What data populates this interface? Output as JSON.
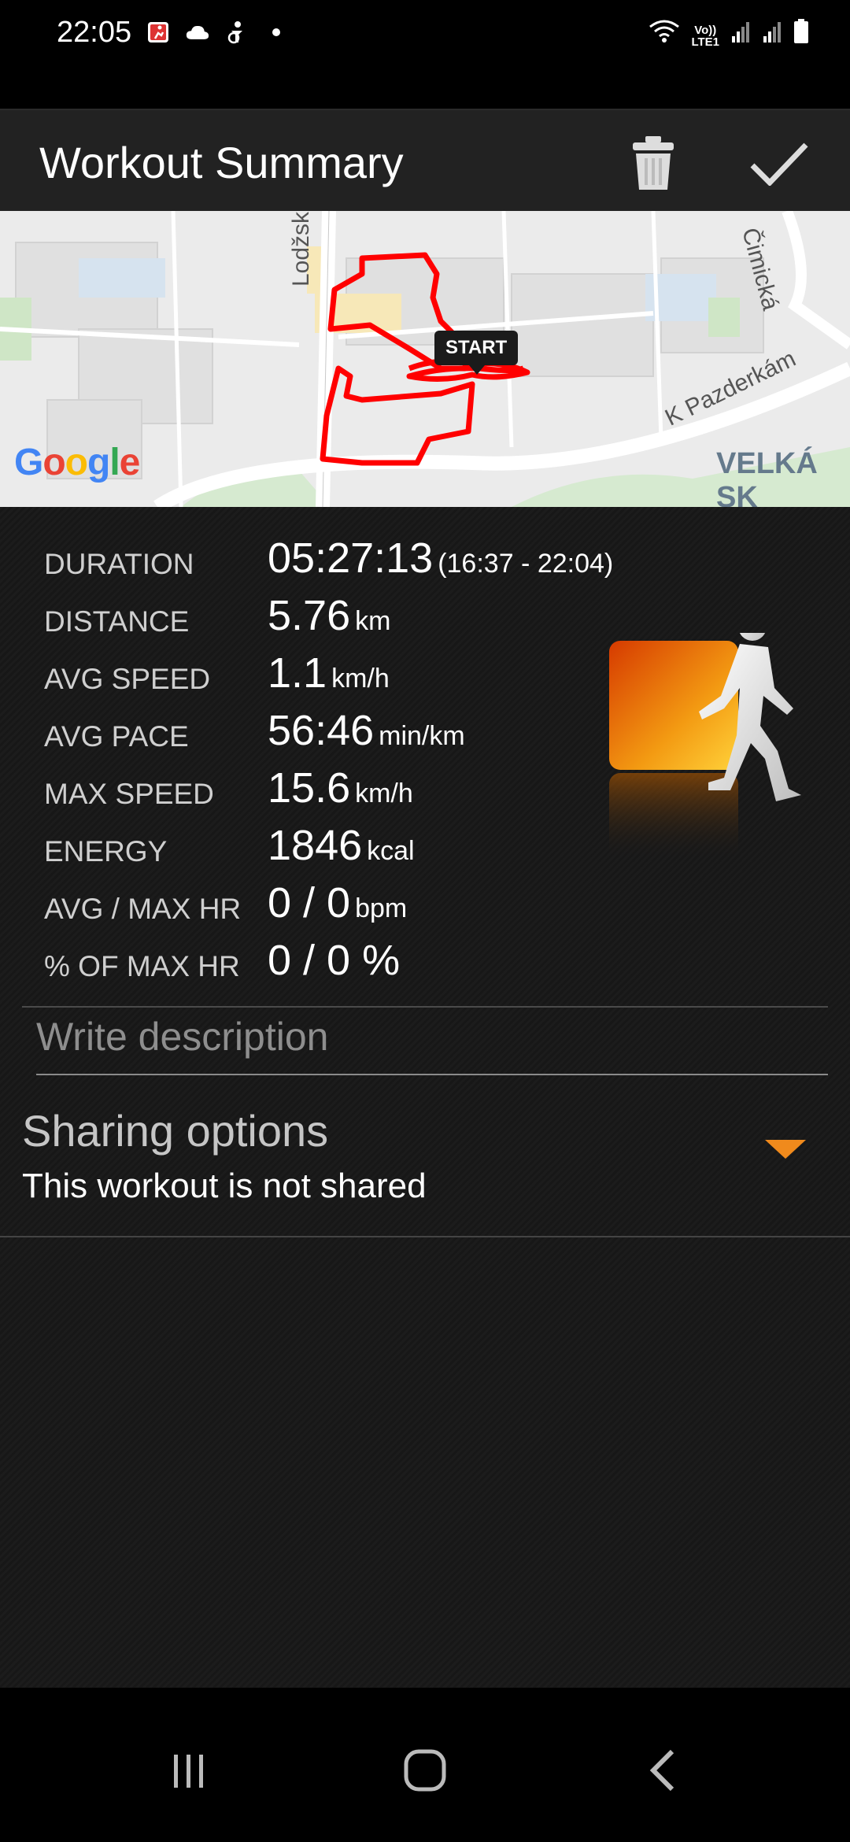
{
  "status_bar": {
    "time": "22:05",
    "icons": [
      "running-app-icon",
      "cloud-icon",
      "accessibility-icon",
      "dot-icon"
    ],
    "network_label_top": "Vo))",
    "network_label_bottom": "LTE1"
  },
  "app_bar": {
    "title": "Workout Summary",
    "actions": [
      "trash-icon",
      "check-icon"
    ]
  },
  "map": {
    "start_label": "START",
    "google_letters": [
      "G",
      "o",
      "o",
      "g",
      "l",
      "e"
    ],
    "google_colors": [
      "#4285F4",
      "#EA4335",
      "#FBBC05",
      "#4285F4",
      "#34A853",
      "#EA4335"
    ],
    "streets": {
      "lodzska": "Lodžská",
      "cimicka": "Čimická",
      "k_pazderkam": "K Pazderkám"
    },
    "district": "VELKÁ SK",
    "route_color": "#ff0000"
  },
  "stats": [
    {
      "label": "DURATION",
      "value": "05:27:13",
      "unit": "(16:37 - 22:04)"
    },
    {
      "label": "DISTANCE",
      "value": "5.76",
      "unit": "km"
    },
    {
      "label": "AVG SPEED",
      "value": "1.1",
      "unit": "km/h"
    },
    {
      "label": "AVG PACE",
      "value": "56:46",
      "unit": "min/km"
    },
    {
      "label": "MAX SPEED",
      "value": "15.6",
      "unit": "km/h"
    },
    {
      "label": "ENERGY",
      "value": "1846",
      "unit": "kcal"
    },
    {
      "label": "AVG / MAX HR",
      "value": "0 / 0",
      "unit": "bpm"
    },
    {
      "label": "% OF MAX HR",
      "value": "0 / 0 %",
      "unit": ""
    }
  ],
  "description": {
    "placeholder": "Write description",
    "value": ""
  },
  "sharing": {
    "title": "Sharing options",
    "status": "This workout is not shared",
    "accent": "#f08a1c"
  },
  "nav_bar": {
    "buttons": [
      "recent-apps-icon",
      "home-icon",
      "back-icon"
    ]
  },
  "activity_icon": "walking-icon"
}
